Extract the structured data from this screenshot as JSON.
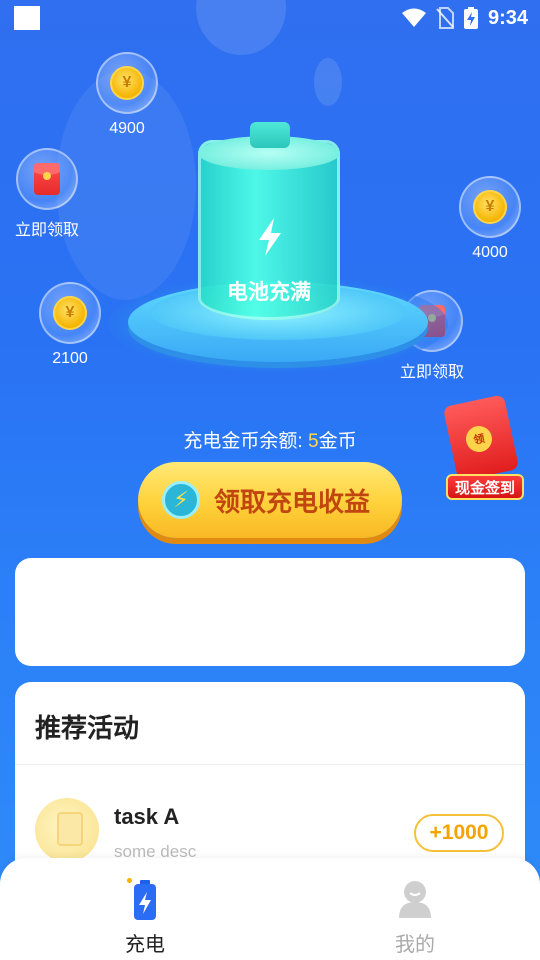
{
  "status_bar": {
    "time": "9:34"
  },
  "coins": [
    {
      "amount": "4900"
    },
    {
      "amount": "4000"
    },
    {
      "amount": "2100"
    }
  ],
  "red_packets": [
    {
      "label": "立即领取"
    },
    {
      "label": "立即领取"
    }
  ],
  "battery": {
    "status_text": "电池充满"
  },
  "balance": {
    "prefix": "充电金币余额: ",
    "amount": "5",
    "unit": "金币"
  },
  "claim_button": {
    "label": "领取充电收益"
  },
  "cash_signin": {
    "label": "现金签到",
    "coin_text": "领"
  },
  "activities": {
    "title": "推荐活动",
    "tasks": [
      {
        "name": "task A",
        "desc": "some desc",
        "reward": "+1000"
      }
    ]
  },
  "nav": {
    "items": [
      {
        "label": "充电"
      },
      {
        "label": "我的"
      }
    ]
  },
  "colors": {
    "accent": "#2f6ff0",
    "gold": "#f5b400",
    "button_text": "#c1450f"
  }
}
